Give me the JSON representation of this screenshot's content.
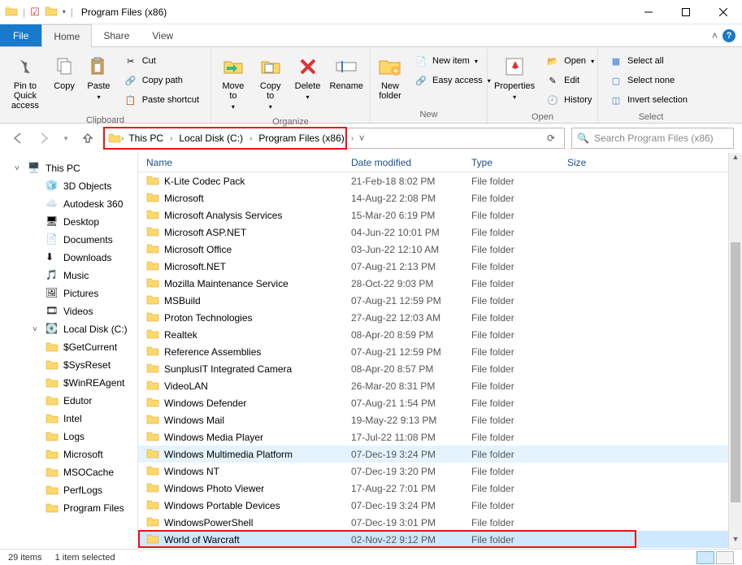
{
  "window": {
    "title": "Program Files (x86)"
  },
  "tabs": {
    "file": "File",
    "home": "Home",
    "share": "Share",
    "view": "View"
  },
  "ribbon": {
    "clipboard": {
      "label": "Clipboard",
      "pin": "Pin to Quick access",
      "copy": "Copy",
      "paste": "Paste",
      "cut": "Cut",
      "copypath": "Copy path",
      "pasteshortcut": "Paste shortcut"
    },
    "organize": {
      "label": "Organize",
      "moveto": "Move to",
      "copyto": "Copy to",
      "delete": "Delete",
      "rename": "Rename"
    },
    "new": {
      "label": "New",
      "newfolder": "New folder",
      "newitem": "New item",
      "easyaccess": "Easy access"
    },
    "open": {
      "label": "Open",
      "properties": "Properties",
      "open": "Open",
      "edit": "Edit",
      "history": "History"
    },
    "select": {
      "label": "Select",
      "selectall": "Select all",
      "selectnone": "Select none",
      "invert": "Invert selection"
    }
  },
  "breadcrumb": [
    "This PC",
    "Local Disk (C:)",
    "Program Files (x86)"
  ],
  "search": {
    "placeholder": "Search Program Files (x86)"
  },
  "nav": [
    {
      "label": "This PC",
      "icon": "pc",
      "indent": 0,
      "expand": "open"
    },
    {
      "label": "3D Objects",
      "icon": "3d",
      "indent": 1
    },
    {
      "label": "Autodesk 360",
      "icon": "cloud",
      "indent": 1
    },
    {
      "label": "Desktop",
      "icon": "desktop",
      "indent": 1
    },
    {
      "label": "Documents",
      "icon": "doc",
      "indent": 1
    },
    {
      "label": "Downloads",
      "icon": "down",
      "indent": 1
    },
    {
      "label": "Music",
      "icon": "music",
      "indent": 1
    },
    {
      "label": "Pictures",
      "icon": "pic",
      "indent": 1
    },
    {
      "label": "Videos",
      "icon": "vid",
      "indent": 1
    },
    {
      "label": "Local Disk (C:)",
      "icon": "disk",
      "indent": 1,
      "expand": "open"
    },
    {
      "label": "$GetCurrent",
      "icon": "folder",
      "indent": 2
    },
    {
      "label": "$SysReset",
      "icon": "folder",
      "indent": 2
    },
    {
      "label": "$WinREAgent",
      "icon": "folder",
      "indent": 2
    },
    {
      "label": "Edutor",
      "icon": "folder",
      "indent": 2
    },
    {
      "label": "Intel",
      "icon": "folder",
      "indent": 2
    },
    {
      "label": "Logs",
      "icon": "folder",
      "indent": 2
    },
    {
      "label": "Microsoft",
      "icon": "folder",
      "indent": 2
    },
    {
      "label": "MSOCache",
      "icon": "folder",
      "indent": 2
    },
    {
      "label": "PerfLogs",
      "icon": "folder",
      "indent": 2
    },
    {
      "label": "Program Files",
      "icon": "folder",
      "indent": 2
    }
  ],
  "columns": {
    "name": "Name",
    "date": "Date modified",
    "type": "Type",
    "size": "Size"
  },
  "files": [
    {
      "name": "K-Lite Codec Pack",
      "date": "21-Feb-18 8:02 PM",
      "type": "File folder"
    },
    {
      "name": "Microsoft",
      "date": "14-Aug-22 2:08 PM",
      "type": "File folder"
    },
    {
      "name": "Microsoft Analysis Services",
      "date": "15-Mar-20 6:19 PM",
      "type": "File folder"
    },
    {
      "name": "Microsoft ASP.NET",
      "date": "04-Jun-22 10:01 PM",
      "type": "File folder"
    },
    {
      "name": "Microsoft Office",
      "date": "03-Jun-22 12:10 AM",
      "type": "File folder"
    },
    {
      "name": "Microsoft.NET",
      "date": "07-Aug-21 2:13 PM",
      "type": "File folder"
    },
    {
      "name": "Mozilla Maintenance Service",
      "date": "28-Oct-22 9:03 PM",
      "type": "File folder"
    },
    {
      "name": "MSBuild",
      "date": "07-Aug-21 12:59 PM",
      "type": "File folder"
    },
    {
      "name": "Proton Technologies",
      "date": "27-Aug-22 12:03 AM",
      "type": "File folder"
    },
    {
      "name": "Realtek",
      "date": "08-Apr-20 8:59 PM",
      "type": "File folder"
    },
    {
      "name": "Reference Assemblies",
      "date": "07-Aug-21 12:59 PM",
      "type": "File folder"
    },
    {
      "name": "SunplusIT Integrated Camera",
      "date": "08-Apr-20 8:57 PM",
      "type": "File folder"
    },
    {
      "name": "VideoLAN",
      "date": "26-Mar-20 8:31 PM",
      "type": "File folder"
    },
    {
      "name": "Windows Defender",
      "date": "07-Aug-21 1:54 PM",
      "type": "File folder"
    },
    {
      "name": "Windows Mail",
      "date": "19-May-22 9:13 PM",
      "type": "File folder"
    },
    {
      "name": "Windows Media Player",
      "date": "17-Jul-22 11:08 PM",
      "type": "File folder"
    },
    {
      "name": "Windows Multimedia Platform",
      "date": "07-Dec-19 3:24 PM",
      "type": "File folder",
      "state": "hover"
    },
    {
      "name": "Windows NT",
      "date": "07-Dec-19 3:20 PM",
      "type": "File folder"
    },
    {
      "name": "Windows Photo Viewer",
      "date": "17-Aug-22 7:01 PM",
      "type": "File folder"
    },
    {
      "name": "Windows Portable Devices",
      "date": "07-Dec-19 3:24 PM",
      "type": "File folder"
    },
    {
      "name": "WindowsPowerShell",
      "date": "07-Dec-19 3:01 PM",
      "type": "File folder"
    },
    {
      "name": "World of Warcraft",
      "date": "02-Nov-22 9:12 PM",
      "type": "File folder",
      "state": "selected",
      "highlight": true
    }
  ],
  "status": {
    "count": "29 items",
    "selected": "1 item selected"
  }
}
